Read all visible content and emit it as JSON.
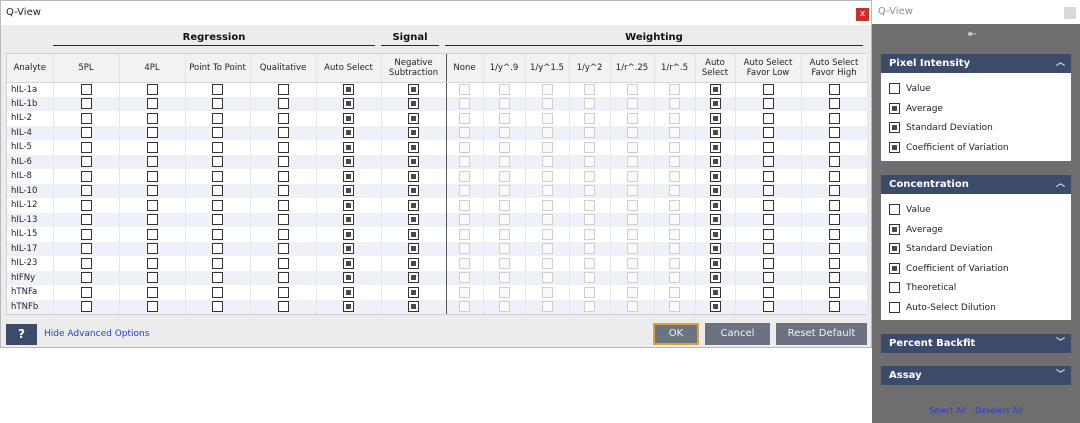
{
  "window": {
    "title": "Q-View",
    "close_label": "x"
  },
  "groups": {
    "regression": "Regression",
    "signal": "Signal",
    "weighting": "Weighting"
  },
  "columns": [
    {
      "label": "Analyte"
    },
    {
      "label": "5PL"
    },
    {
      "label": "4PL"
    },
    {
      "label": "Point To Point"
    },
    {
      "label": "Qualitative"
    },
    {
      "label": "Auto Select"
    },
    {
      "label": "Negative Subtraction"
    },
    {
      "label": "None"
    },
    {
      "label": "1/y^.9"
    },
    {
      "label": "1/y^1.5"
    },
    {
      "label": "1/y^2"
    },
    {
      "label": "1/r^.25"
    },
    {
      "label": "1/r^.5"
    },
    {
      "label": "Auto Select"
    },
    {
      "label": "Auto Select Favor Low"
    },
    {
      "label": "Auto Select Favor High"
    }
  ],
  "rows": [
    {
      "analyte": "hIL-1a"
    },
    {
      "analyte": "hIL-1b"
    },
    {
      "analyte": "hIL-2"
    },
    {
      "analyte": "hIL-4"
    },
    {
      "analyte": "hIL-5"
    },
    {
      "analyte": "hIL-6"
    },
    {
      "analyte": "hIL-8"
    },
    {
      "analyte": "hIL-10"
    },
    {
      "analyte": "hIL-12"
    },
    {
      "analyte": "hIL-13"
    },
    {
      "analyte": "hIL-15"
    },
    {
      "analyte": "hIL-17"
    },
    {
      "analyte": "hIL-23"
    },
    {
      "analyte": "hIFNy"
    },
    {
      "analyte": "hTNFa"
    },
    {
      "analyte": "hTNFb"
    }
  ],
  "column_state": {
    "checked": [
      false,
      false,
      false,
      false,
      true,
      true,
      false,
      false,
      false,
      false,
      false,
      false,
      true,
      false,
      false
    ],
    "disabled": [
      false,
      false,
      false,
      false,
      false,
      false,
      true,
      true,
      true,
      true,
      true,
      true,
      false,
      false,
      false
    ]
  },
  "footer": {
    "help_label": "?",
    "hide_advanced": "Hide Advanced Options",
    "ok": "OK",
    "cancel": "Cancel",
    "reset": "Reset Default"
  },
  "side": {
    "title": "Q-View",
    "pixel_intensity": {
      "title": "Pixel Intensity",
      "options": [
        {
          "label": "Value",
          "checked": false
        },
        {
          "label": "Average",
          "checked": true
        },
        {
          "label": "Standard Deviation",
          "checked": true
        },
        {
          "label": "Coefficient of Variation",
          "checked": true
        }
      ]
    },
    "concentration": {
      "title": "Concentration",
      "options": [
        {
          "label": "Value",
          "checked": false
        },
        {
          "label": "Average",
          "checked": true
        },
        {
          "label": "Standard Deviation",
          "checked": true
        },
        {
          "label": "Coefficient of Variation",
          "checked": true
        },
        {
          "label": "Theoretical",
          "checked": false
        },
        {
          "label": "Auto-Select Dilution",
          "checked": false
        }
      ]
    },
    "percent_backfit": {
      "title": "Percent Backfit"
    },
    "assay": {
      "title": "Assay"
    },
    "select_all": "Select All",
    "deselect_all": "Deselect All"
  },
  "colors": {
    "header_blue": "#3c4a6b",
    "button_gray": "#6b7282",
    "close_red": "#c9302c",
    "link_blue": "#2a3bd6"
  }
}
